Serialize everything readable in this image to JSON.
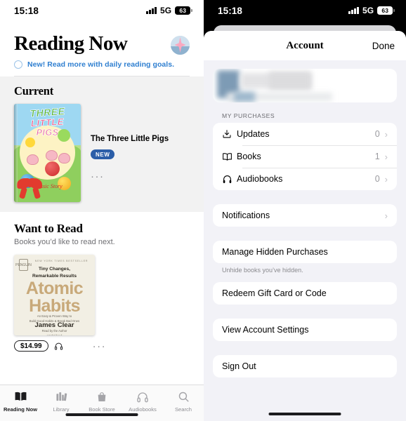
{
  "status_bar": {
    "time": "15:18",
    "network": "5G",
    "battery": "63"
  },
  "reading_now": {
    "title": "Reading Now",
    "goal_banner": "New! Read more with daily reading goals.",
    "avatar_name": "profile-avatar",
    "current": {
      "section_title": "Current",
      "book_title": "The Three Little Pigs",
      "badge": "NEW",
      "more": "···",
      "cover": {
        "line1": "THREE",
        "line2": "LITTLE",
        "line3": "PIGS",
        "tagline": "Classic Story"
      }
    },
    "want_to_read": {
      "section_title": "Want to Read",
      "subtitle": "Books you’d like to read next.",
      "price": "$14.99",
      "more": "···",
      "cover": {
        "imprint": "PENGUIN",
        "nyt": "NEW YORK TIMES BESTSELLER",
        "tagline": "Tiny Changes,\nRemarkable Results",
        "title_line1": "Atomic",
        "title_line2": "Habits",
        "subtitle": "An Easy & Proven Way to\nBuild Good Habits & Break Bad Ones",
        "author": "James Clear",
        "narration": "Read by the Author\nUnabridged"
      }
    },
    "tabs": [
      {
        "label": "Reading Now",
        "icon": "open-book-icon",
        "active": true
      },
      {
        "label": "Library",
        "icon": "bookshelf-icon",
        "active": false
      },
      {
        "label": "Book Store",
        "icon": "shopping-bag-icon",
        "active": false
      },
      {
        "label": "Audiobooks",
        "icon": "headphones-icon",
        "active": false
      },
      {
        "label": "Search",
        "icon": "search-icon",
        "active": false
      }
    ]
  },
  "account_sheet": {
    "nav_title": "Account",
    "done_label": "Done",
    "profile_redacted": true,
    "purchases_label": "MY PURCHASES",
    "purchases": [
      {
        "label": "Updates",
        "count": "0",
        "icon": "download-icon"
      },
      {
        "label": "Books",
        "count": "1",
        "icon": "open-book-icon"
      },
      {
        "label": "Audiobooks",
        "count": "0",
        "icon": "headphones-icon"
      }
    ],
    "notifications_label": "Notifications",
    "hidden_purchases_label": "Manage Hidden Purchases",
    "hidden_purchases_footer": "Unhide books you’ve hidden.",
    "redeem_label": "Redeem Gift Card or Code",
    "account_settings_label": "View Account Settings",
    "sign_out_label": "Sign Out"
  },
  "colors": {
    "accent_blue": "#2f7fd0",
    "badge_blue": "#2b5ea8",
    "sheet_bg": "#f2f2f7",
    "card_white": "#ffffff",
    "band_gray": "#f2f2f2"
  }
}
